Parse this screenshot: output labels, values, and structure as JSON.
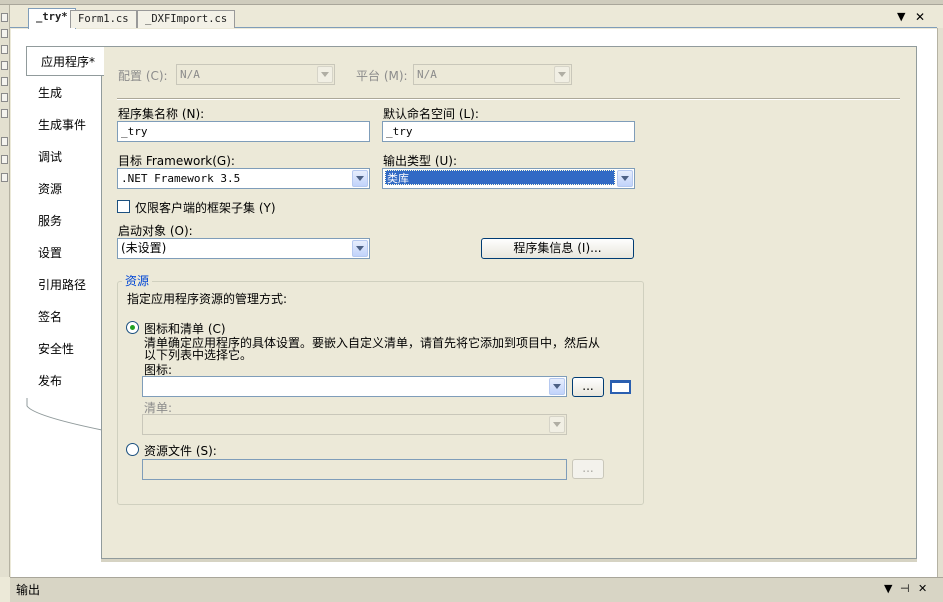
{
  "tabs": [
    {
      "label": "_try*",
      "active": true
    },
    {
      "label": "Form1.cs",
      "active": false
    },
    {
      "label": "_DXFImport.cs",
      "active": false
    }
  ],
  "tab_controls": {
    "dropdown": "▼",
    "close": "✕"
  },
  "sidebar": {
    "items": [
      {
        "label": "应用程序*",
        "selected": true
      },
      {
        "label": "生成"
      },
      {
        "label": "生成事件"
      },
      {
        "label": "调试"
      },
      {
        "label": "资源"
      },
      {
        "label": "服务"
      },
      {
        "label": "设置"
      },
      {
        "label": "引用路径"
      },
      {
        "label": "签名"
      },
      {
        "label": "安全性"
      },
      {
        "label": "发布"
      }
    ]
  },
  "config": {
    "config_label": "配置 (C):",
    "config_value": "N/A",
    "platform_label": "平台 (M):",
    "platform_value": "N/A"
  },
  "assembly": {
    "name_label": "程序集名称 (N):",
    "name_value": "_try",
    "namespace_label": "默认命名空间 (L):",
    "namespace_value": "_try",
    "framework_label": "目标 Framework(G):",
    "framework_value": ".NET Framework 3.5",
    "output_type_label": "输出类型 (U):",
    "output_type_value": "类库",
    "client_subset_label": "仅限客户端的框架子集 (Y)",
    "startup_label": "启动对象 (O):",
    "startup_value": "(未设置)",
    "assembly_info_button": "程序集信息 (I)..."
  },
  "resources": {
    "group_title": "资源",
    "description": "指定应用程序资源的管理方式:",
    "icon_manifest_label": "图标和清单 (C)",
    "icon_manifest_help_line1": "清单确定应用程序的具体设置。要嵌入自定义清单，请首先将它添加到项目中，然后从",
    "icon_manifest_help_line2": "以下列表中选择它。",
    "icon_label": "图标:",
    "icon_value": "",
    "browse_label": "...",
    "manifest_label": "清单:",
    "manifest_value": "",
    "resource_file_label": "资源文件 (S):",
    "resource_file_value": "",
    "resource_browse_label": "..."
  },
  "output_panel": {
    "title": "输出",
    "controls": [
      "▼",
      "⊣",
      "✕"
    ]
  }
}
